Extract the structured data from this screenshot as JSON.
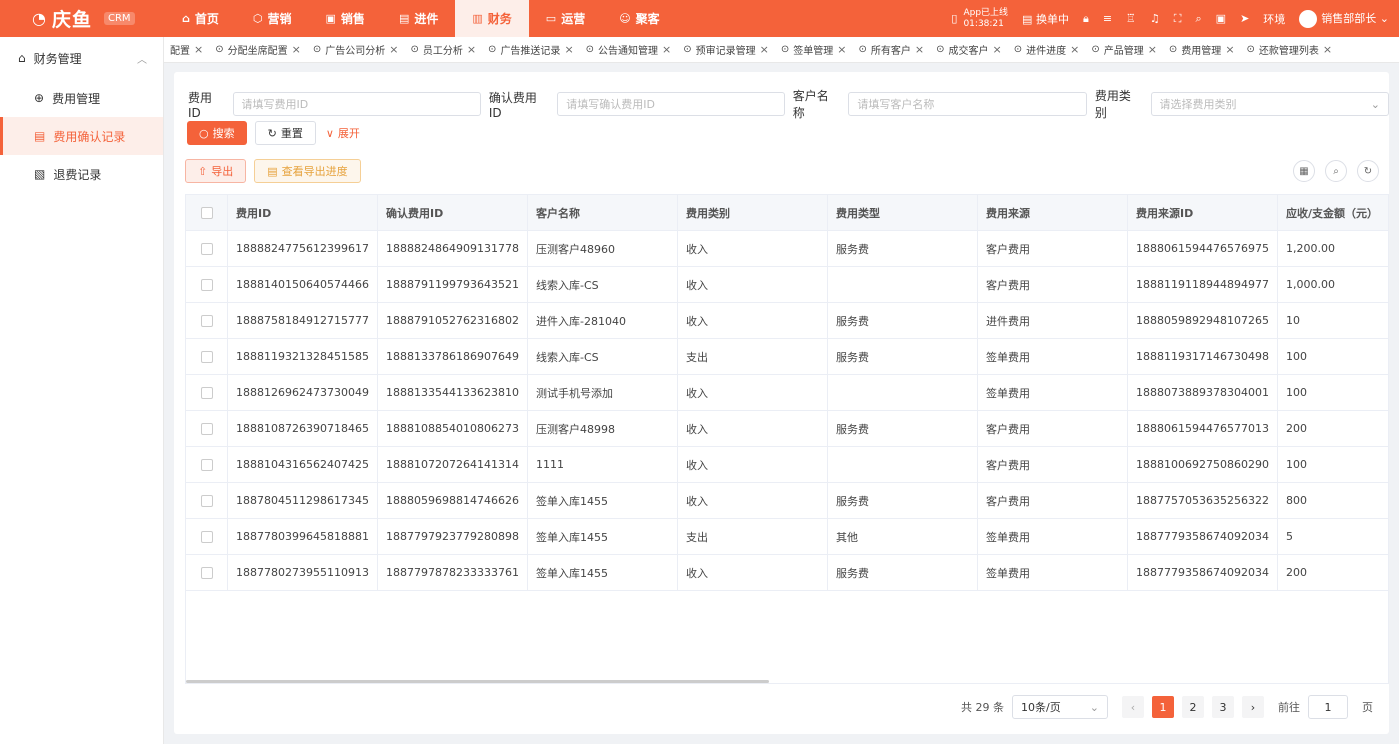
{
  "brand": {
    "name": "庆鱼",
    "badge": "CRM"
  },
  "nav": [
    {
      "label": "首页",
      "icon": "home-icon"
    },
    {
      "label": "营销",
      "icon": "marketing-icon"
    },
    {
      "label": "销售",
      "icon": "sales-icon"
    },
    {
      "label": "进件",
      "icon": "document-icon"
    },
    {
      "label": "财务",
      "icon": "finance-icon",
      "active": true
    },
    {
      "label": "运营",
      "icon": "operation-icon"
    },
    {
      "label": "聚客",
      "icon": "users-icon"
    }
  ],
  "topright": {
    "app_status": "App已上线",
    "app_time": "01:38:21",
    "approve": "换单中",
    "env": "环境",
    "user": "销售部部长"
  },
  "sidebar": {
    "group": "财务管理",
    "items": [
      "费用管理",
      "费用确认记录",
      "退费记录"
    ]
  },
  "tabs": [
    "配置",
    "分配坐席配置",
    "广告公司分析",
    "员工分析",
    "广告推送记录",
    "公告通知管理",
    "预审记录管理",
    "签单管理",
    "所有客户",
    "成交客户",
    "进件进度",
    "产品管理",
    "费用管理",
    "还款管理列表"
  ],
  "filters": {
    "fee_id_label": "费用ID",
    "fee_id_ph": "请填写费用ID",
    "confirm_id_label": "确认费用ID",
    "confirm_id_ph": "请填写确认费用ID",
    "customer_label": "客户名称",
    "customer_ph": "请填写客户名称",
    "category_label": "费用类别",
    "category_ph": "请选择费用类别"
  },
  "buttons": {
    "search": "搜索",
    "reset": "重置",
    "expand": "展开",
    "export": "导出",
    "progress": "查看导出进度"
  },
  "table": {
    "headers": [
      "费用ID",
      "确认费用ID",
      "客户名称",
      "费用类别",
      "费用类型",
      "费用来源",
      "费用来源ID",
      "应收/支金额（元）"
    ],
    "rows": [
      [
        "1888824775612399617",
        "1888824864909131778",
        "压测客户48960",
        "收入",
        "服务费",
        "客户费用",
        "1888061594476576975",
        "1,200.00"
      ],
      [
        "1888140150640574466",
        "1888791199793643521",
        "线索入库-CS",
        "收入",
        "",
        "客户费用",
        "1888119118944894977",
        "1,000.00"
      ],
      [
        "1888758184912715777",
        "1888791052762316802",
        "进件入库-281040",
        "收入",
        "服务费",
        "进件费用",
        "1888059892948107265",
        "10"
      ],
      [
        "1888119321328451585",
        "1888133786186907649",
        "线索入库-CS",
        "支出",
        "服务费",
        "签单费用",
        "1888119317146730498",
        "100"
      ],
      [
        "1888126962473730049",
        "1888133544133623810",
        "测试手机号添加",
        "收入",
        "",
        "签单费用",
        "1888073889378304001",
        "100"
      ],
      [
        "1888108726390718465",
        "1888108854010806273",
        "压测客户48998",
        "收入",
        "服务费",
        "客户费用",
        "1888061594476577013",
        "200"
      ],
      [
        "1888104316562407425",
        "1888107207264141314",
        "1111",
        "收入",
        "",
        "客户费用",
        "1888100692750860290",
        "100"
      ],
      [
        "1887804511298617345",
        "1888059698814746626",
        "签单入库1455",
        "收入",
        "服务费",
        "客户费用",
        "1887757053635256322",
        "800"
      ],
      [
        "1887780399645818881",
        "1887797923779280898",
        "签单入库1455",
        "支出",
        "其他",
        "签单费用",
        "1887779358674092034",
        "5"
      ],
      [
        "1887780273955110913",
        "1887797878233333761",
        "签单入库1455",
        "收入",
        "服务费",
        "签单费用",
        "1887779358674092034",
        "200"
      ]
    ]
  },
  "pager": {
    "total": "共 29 条",
    "size": "10条/页",
    "pages": [
      "1",
      "2",
      "3"
    ],
    "goto": "前往",
    "page_unit": "页",
    "current": "1"
  }
}
